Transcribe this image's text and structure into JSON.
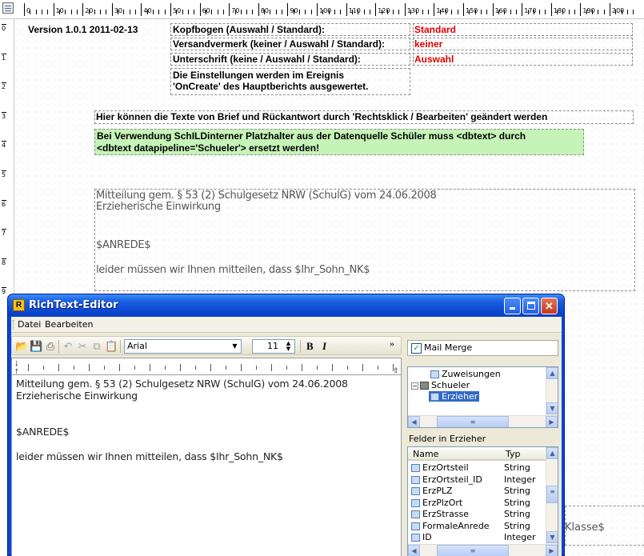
{
  "ruler": {
    "labels": [
      "0",
      "10",
      "20",
      "30",
      "40",
      "50",
      "60",
      "70",
      "80",
      "90",
      "100",
      "110",
      "120",
      "130",
      "140",
      "150",
      "160",
      "170",
      "180",
      "190",
      "200"
    ],
    "vlabels": [
      "0",
      "1",
      "2",
      "3",
      "4",
      "5",
      "6",
      "7",
      "8",
      "9"
    ]
  },
  "report": {
    "version": "Version 1.0.1 2011-02-13",
    "kopfbogen_label": "Kopfbogen  (Auswahl / Standard):",
    "kopfbogen_value": "Standard",
    "versand_label": "Versandvermerk (keiner / Auswahl / Standard):",
    "versand_value": "keiner",
    "unterschrift_label": "Unterschrift (keine / Auswahl / Standard):",
    "unterschrift_value": "Auswahl",
    "einstellungen_line1": "Die Einstellungen werden im Ereignis",
    "einstellungen_line2": "'OnCreate' des Hauptberichts ausgewertet.",
    "hint": "Hier können die Texte von Brief und Rückantwort durch 'Rechtsklick / Bearbeiten' geändert werden",
    "green_line1": "Bei Verwendung SchILDinterner Platzhalter aus der Datenquelle Schüler muss <dbtext> durch",
    "green_line2": "<dbtext datapipeline='Schueler'> ersetzt werden!",
    "body_line1": "Mitteilung gem. § 53 (2) Schulgesetz NRW (SchulG) vom 24.06.2008",
    "body_line2": "Erzieherische Einwirkung",
    "anrede": "$ANREDE$",
    "leider": "leider müssen wir Ihnen mitteilen, dass $Ihr_Sohn_NK$",
    "klasse": "Klasse$"
  },
  "editor": {
    "title": "RichText-Editor",
    "app_icon_glyph": "R",
    "menu": [
      "Datei",
      "Bearbeiten"
    ],
    "font_name": "Arial",
    "font_size": "11",
    "bold_label": "B",
    "italic_label": "I",
    "overflow_label": "»",
    "text_line1": "Mitteilung gem. § 53 (2) Schulgesetz NRW (SchulG) vom 24.06.2008",
    "text_line2": "Erzieherische Einwirkung",
    "text_anrede": "$ANREDE$",
    "text_leider": "leider müssen wir Ihnen mitteilen, dass $Ihr_Sohn_NK$",
    "mail_merge_label": "Mail Merge",
    "tree": [
      {
        "label": "Zuweisungen",
        "level": 2
      },
      {
        "label": "Schueler",
        "level": 1
      },
      {
        "label": "Erzieher",
        "level": 2,
        "selected": true
      }
    ],
    "felder_label": "Felder in Erzieher",
    "grid_header": {
      "name": "Name",
      "typ": "Typ"
    },
    "fields": [
      {
        "name": "ErzOrtsteil",
        "typ": "String"
      },
      {
        "name": "ErzOrtsteil_ID",
        "typ": "Integer"
      },
      {
        "name": "ErzPLZ",
        "typ": "String"
      },
      {
        "name": "ErzPlzOrt",
        "typ": "String"
      },
      {
        "name": "ErzStrasse",
        "typ": "String"
      },
      {
        "name": "FormaleAnrede",
        "typ": "String"
      },
      {
        "name": "ID",
        "typ": "Integer"
      }
    ]
  },
  "colors": {
    "red_value": "#e00000",
    "green_box": "#c6f3b8",
    "title_blue": "#0a44d8",
    "selection": "#316ac5"
  }
}
